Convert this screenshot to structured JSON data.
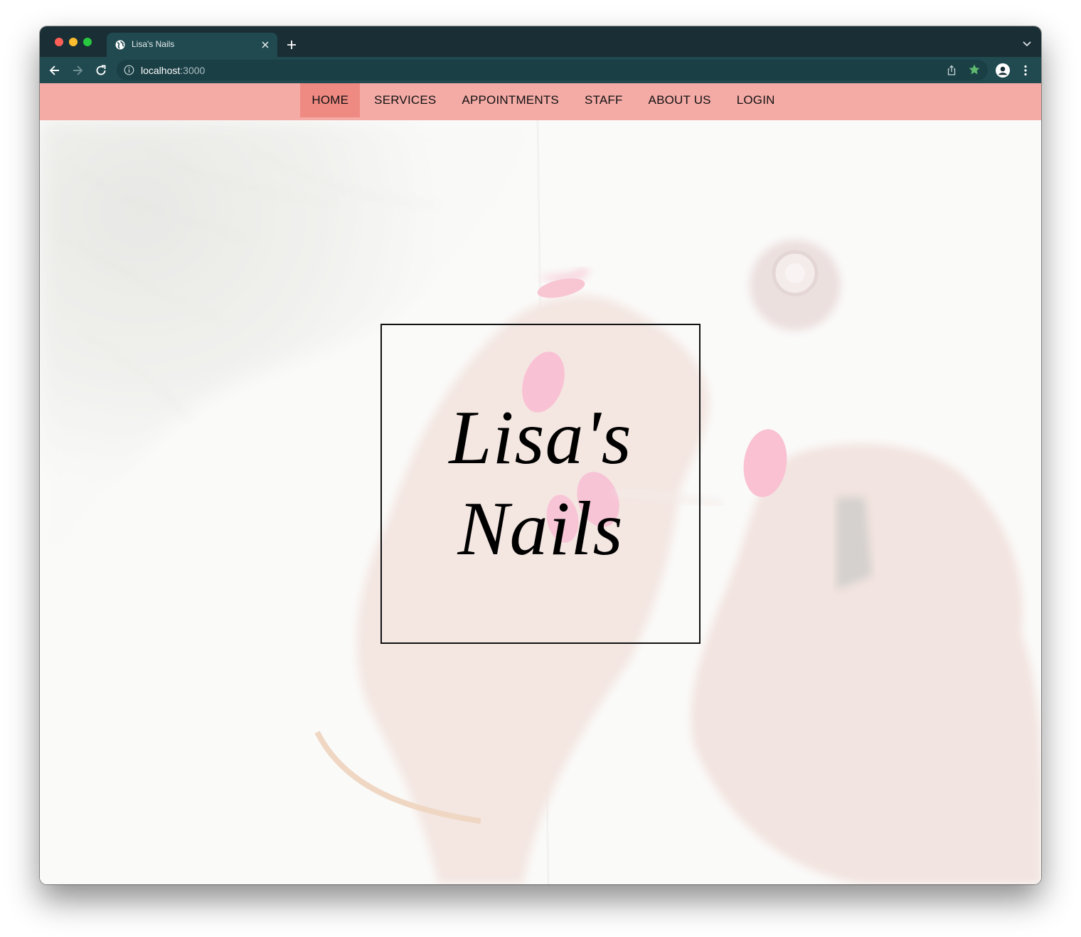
{
  "browser": {
    "tab_title": "Lisa's Nails",
    "url_host": "localhost",
    "url_port": ":3000"
  },
  "nav": {
    "items": [
      {
        "label": "HOME",
        "active": true
      },
      {
        "label": "SERVICES",
        "active": false
      },
      {
        "label": "APPOINTMENTS",
        "active": false
      },
      {
        "label": "STAFF",
        "active": false
      },
      {
        "label": "ABOUT US",
        "active": false
      },
      {
        "label": "LOGIN",
        "active": false
      }
    ]
  },
  "hero": {
    "title_line_1": "Lisa's",
    "title_line_2": "Nails",
    "background_image": "hands-painting-pink-nails-photo"
  },
  "colors": {
    "nav_background": "#f4aba6",
    "nav_active": "#ef8a82",
    "browser_frame": "#1a2e35",
    "browser_toolbar": "#204a50",
    "bookmark_star": "#5fb86f"
  }
}
